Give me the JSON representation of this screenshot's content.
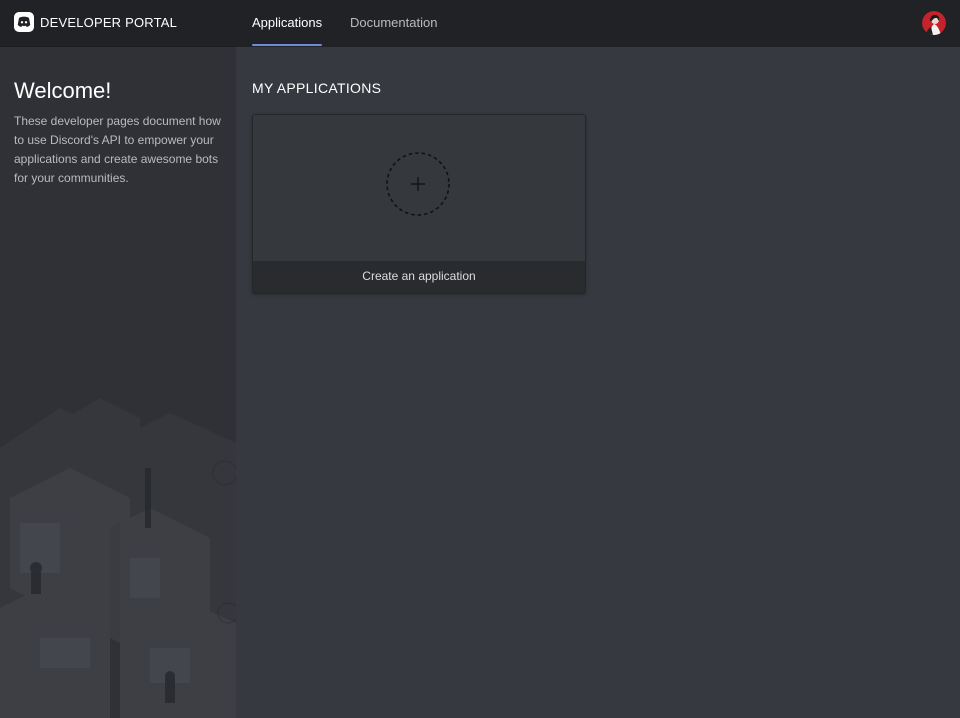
{
  "header": {
    "brand": "DEVELOPER PORTAL",
    "tabs": [
      {
        "label": "Applications",
        "active": true
      },
      {
        "label": "Documentation",
        "active": false
      }
    ],
    "logo_icon": "discord-logo-icon",
    "avatar_icon": "user-avatar"
  },
  "sidebar": {
    "title": "Welcome!",
    "description": "These developer pages document how to use Discord's API to empower your applications and create awesome bots for your communities."
  },
  "main": {
    "section_title": "MY APPLICATIONS",
    "create_card": {
      "label": "Create an application",
      "icon": "plus-icon"
    }
  },
  "colors": {
    "header_bg": "#202225",
    "sidebar_bg": "#2f3136",
    "main_bg": "#36393f",
    "accent": "#7289da"
  }
}
